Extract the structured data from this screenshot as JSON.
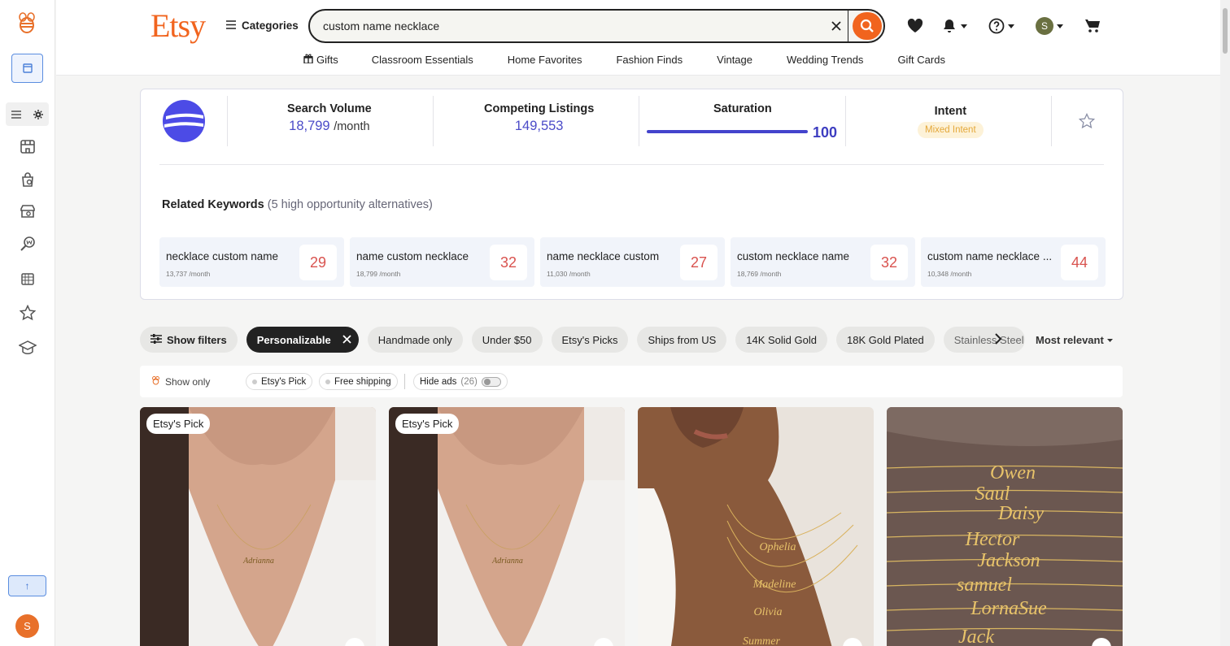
{
  "sidebar": {
    "items": [
      "menu-list-icon",
      "settings-icon",
      "shop-icon",
      "product-search-icon",
      "store-search-icon",
      "keyword-tool-icon",
      "calendar-icon",
      "star-icon",
      "academy-icon"
    ],
    "scroll_top_label": "↑",
    "user_initial": "S"
  },
  "header": {
    "logo": "Etsy",
    "categories_label": "Categories",
    "search_value": "custom name necklace",
    "user_initial": "S",
    "nav": [
      "Gifts",
      "Classroom Essentials",
      "Home Favorites",
      "Fashion Finds",
      "Vintage",
      "Wedding Trends",
      "Gift Cards"
    ]
  },
  "insights": {
    "search_volume_label": "Search Volume",
    "search_volume": "18,799",
    "search_volume_unit": "/month",
    "competing_label": "Competing Listings",
    "competing": "149,553",
    "saturation_label": "Saturation",
    "saturation": "100",
    "intent_label": "Intent",
    "intent": "Mixed Intent",
    "related_title": "Related Keywords",
    "related_sub": "(5 high opportunity alternatives)",
    "keywords": [
      {
        "kw": "necklace custom name",
        "vol": "13,737 /month",
        "score": "29"
      },
      {
        "kw": "name custom necklace",
        "vol": "18,799 /month",
        "score": "32"
      },
      {
        "kw": "name necklace custom",
        "vol": "11,030 /month",
        "score": "27"
      },
      {
        "kw": "custom necklace name",
        "vol": "18,769 /month",
        "score": "32"
      },
      {
        "kw": "custom name necklace ...",
        "vol": "10,348 /month",
        "score": "44"
      }
    ]
  },
  "filters": {
    "show_filters": "Show filters",
    "chips": [
      "Personalizable",
      "Handmade only",
      "Under $50",
      "Etsy's Picks",
      "Ships from US",
      "14K Solid Gold",
      "18K Gold Plated",
      "Stainless Steel"
    ],
    "sort": "Most relevant"
  },
  "showonly": {
    "label": "Show only",
    "etsys_pick": "Etsy's Pick",
    "free_shipping": "Free shipping",
    "hide_ads": "Hide ads",
    "ads_count": "(26)"
  },
  "listings": [
    {
      "badge": "Etsy's Pick"
    },
    {
      "badge": "Etsy's Pick"
    },
    {
      "badge": ""
    },
    {
      "badge": ""
    }
  ],
  "colors": {
    "accent": "#f1641e",
    "brand": "#4c4be6",
    "score": "#d9534f"
  }
}
